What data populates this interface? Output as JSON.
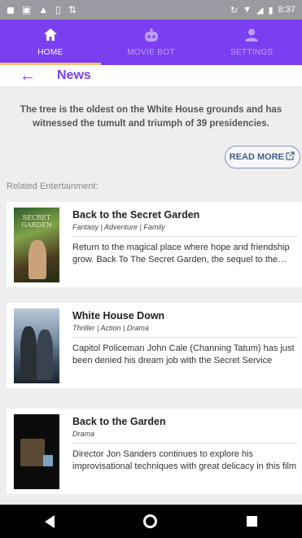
{
  "status_bar": {
    "left_icons": [
      "notification-icon",
      "message-icon",
      "alert-icon",
      "sim-icon",
      "transfer-icon"
    ],
    "right_icons": [
      "sync-icon",
      "wifi-icon",
      "signal-icon",
      "battery-icon"
    ],
    "time": "8:37"
  },
  "tabs": [
    {
      "label": "HOME",
      "icon": "home-icon",
      "active": true
    },
    {
      "label": "MOVIE BOT",
      "icon": "robot-icon",
      "active": false
    },
    {
      "label": "SETTINGS",
      "icon": "person-icon",
      "active": false
    }
  ],
  "header": {
    "title": "News",
    "back_icon": "arrow-left-icon"
  },
  "article": {
    "summary": "The tree is the oldest on the White House grounds and has witnessed the tumult and triumph of 39 presidencies.",
    "read_more": "READ MORE",
    "related_label": "Related Entertainment:"
  },
  "related": [
    {
      "title": "Back to the Secret Garden",
      "genres": "Fantasy | Adventure | Family",
      "description": "Return to the magical place where hope and friendship grow. Back To The Secret Garden, the sequel to the classic film",
      "poster_text": "SECRET GARDEN"
    },
    {
      "title": "White House Down",
      "genres": "Thriller | Action | Drama",
      "description": "Capitol Policeman John Cale (Channing Tatum) has just been denied his dream job with the Secret Service",
      "poster_text": ""
    },
    {
      "title": "Back to the Garden",
      "genres": "Drama",
      "description": "Director Jon Sanders continues to explore his improvisational techniques with great delicacy in this film",
      "poster_text": ""
    }
  ],
  "colors": {
    "primary": "#7b3ff2",
    "tab_indicator": "#f3c26b",
    "read_more_border": "#7c95b8"
  }
}
